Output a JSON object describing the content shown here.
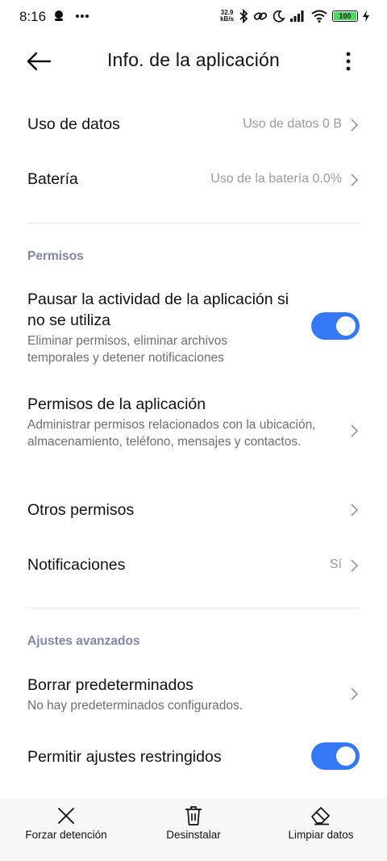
{
  "status_bar": {
    "time": "8:16",
    "speed_value": "32.9",
    "speed_unit": "kB/s",
    "battery": "100"
  },
  "header": {
    "title": "Info. de la aplicación"
  },
  "rows": {
    "data_usage": {
      "title": "Uso de datos",
      "value": "Uso de datos 0 B"
    },
    "battery": {
      "title": "Batería",
      "value": "Uso de la batería 0.0%"
    },
    "pause_activity": {
      "title": "Pausar la actividad de la aplicación si no se utiliza",
      "subtitle": "Eliminar permisos, eliminar archivos temporales y detener notificaciones",
      "toggle_on": true
    },
    "app_permissions": {
      "title": "Permisos de la aplicación",
      "subtitle": "Administrar permisos relacionados con la ubicación, almacenamiento, teléfono, mensajes y contactos."
    },
    "other_permissions": {
      "title": "Otros permisos"
    },
    "notifications": {
      "title": "Notificaciones",
      "value": "Sí"
    },
    "clear_defaults": {
      "title": "Borrar predeterminados",
      "subtitle": "No hay predeterminados configurados."
    },
    "restricted_settings": {
      "title": "Permitir ajustes restringidos",
      "toggle_on": true
    }
  },
  "sections": {
    "permissions": "Permisos",
    "advanced": "Ajustes avanzados"
  },
  "bottom_bar": {
    "force_stop": "Forzar detención",
    "uninstall": "Desinstalar",
    "clear_data": "Limpiar datos"
  },
  "colors": {
    "accent": "#3478f6",
    "section_header": "#7f86a6"
  },
  "icons": [
    "back-arrow-icon",
    "more-vertical-icon",
    "chevron-right-icon",
    "close-icon",
    "trash-icon",
    "eraser-icon",
    "bluetooth-icon",
    "wifi-icon",
    "signal-icon",
    "moon-icon",
    "link-icon"
  ]
}
